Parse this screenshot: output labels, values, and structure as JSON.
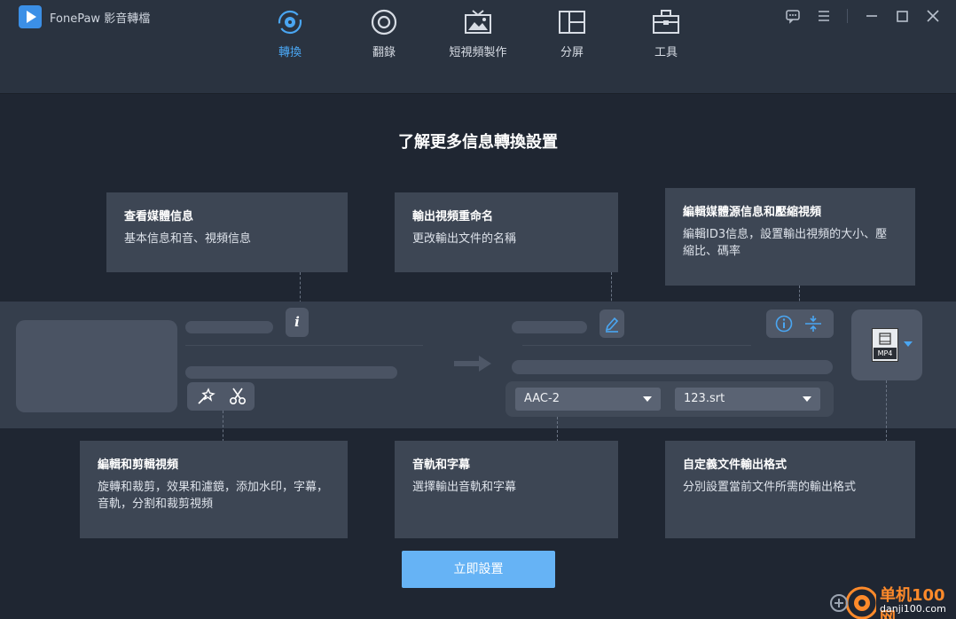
{
  "app": {
    "title": "FonePaw 影音轉檔"
  },
  "nav": {
    "items": [
      {
        "label": "轉換",
        "active": true,
        "icon": "convert-icon"
      },
      {
        "label": "翻錄",
        "active": false,
        "icon": "disc-icon"
      },
      {
        "label": "短視頻製作",
        "active": false,
        "icon": "tv-image-icon"
      },
      {
        "label": "分屏",
        "active": false,
        "icon": "split-screen-icon"
      },
      {
        "label": "工具",
        "active": false,
        "icon": "toolbox-icon"
      }
    ]
  },
  "guide": {
    "heading": "了解更多信息轉換設置",
    "cards": {
      "media_info": {
        "title": "查看媒體信息",
        "desc": "基本信息和音、視頻信息"
      },
      "rename": {
        "title": "輸出視頻重命名",
        "desc": "更改輸出文件的名稱"
      },
      "edit_meta": {
        "title": "編輯媒體源信息和壓縮視頻",
        "desc": "編輯ID3信息，設置輸出視頻的大小、壓縮比、碼率"
      },
      "edit_cut": {
        "title": "編輯和剪輯視頻",
        "desc": "旋轉和裁剪，效果和濾鏡，添加水印，字幕，音軌，分割和裁剪視頻"
      },
      "audio_sub": {
        "title": "音軌和字幕",
        "desc": "選擇輸出音軌和字幕"
      },
      "format": {
        "title": "自定義文件輸出格式",
        "desc": "分別設置當前文件所需的輸出格式"
      }
    }
  },
  "file_row": {
    "audio_track": "AAC-2",
    "subtitle": "123.srt",
    "format_label": "MP4"
  },
  "action": {
    "label": "立即設置"
  },
  "watermark": {
    "brand": "单机100网",
    "url": "danji100.com"
  },
  "colors": {
    "accent": "#4aa6f2",
    "button": "#66b3f5",
    "bg": "#1f2632",
    "card": "#3d4654"
  }
}
